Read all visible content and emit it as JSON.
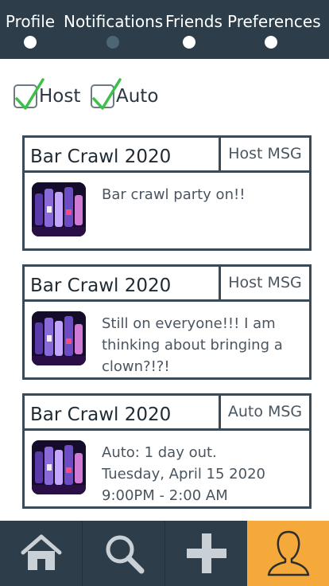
{
  "tabs": [
    {
      "label": "Profile",
      "active": false
    },
    {
      "label": "Notifications",
      "active": true
    },
    {
      "label": "Friends",
      "active": false
    },
    {
      "label": "Preferences",
      "active": false
    }
  ],
  "filters": [
    {
      "label": "Host",
      "checked": true
    },
    {
      "label": "Auto",
      "checked": true
    }
  ],
  "notifications": [
    {
      "title": "Bar Crawl 2020",
      "type": "Host MSG",
      "message_lines": [
        "Bar crawl party on!!"
      ]
    },
    {
      "title": "Bar Crawl 2020",
      "type": "Host MSG",
      "message_lines": [
        "Still on everyone!!! I am",
        "thinking about bringing a",
        "clown?!?!"
      ]
    },
    {
      "title": "Bar Crawl 2020",
      "type": "Auto MSG",
      "message_lines": [
        "Auto: 1 day out.",
        "Tuesday, April 15 2020",
        "9:00PM - 2:00 AM"
      ]
    }
  ],
  "bottom_nav": [
    {
      "icon": "home-icon",
      "active": false
    },
    {
      "icon": "search-icon",
      "active": false
    },
    {
      "icon": "plus-icon",
      "active": false
    },
    {
      "icon": "user-profile-icon",
      "active": true
    }
  ],
  "colors": {
    "bar": "#2d3e4a",
    "active_nav": "#f4a93a",
    "check": "#3dbf4a",
    "card_border": "#3a4b57"
  }
}
